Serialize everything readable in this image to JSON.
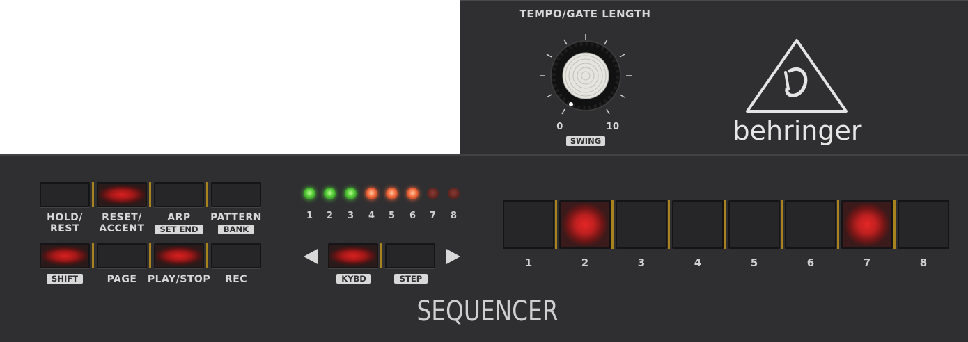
{
  "knob": {
    "title": "TEMPO/GATE LENGTH",
    "min_label": "0",
    "max_label": "10",
    "swing_tag": "SWING",
    "value_fraction": 0.08
  },
  "brand": {
    "name": "behringer",
    "logo_icon": "behringer-triangle-logo-icon"
  },
  "buttons": [
    {
      "line1": "HOLD/",
      "line2": "REST",
      "lit": false
    },
    {
      "line1": "RESET/",
      "line2": "ACCENT",
      "lit": true
    },
    {
      "line1": "ARP",
      "tag": "SET END",
      "lit": false
    },
    {
      "line1": "PATTERN",
      "tag": "BANK",
      "lit": false
    },
    {
      "tag": "SHIFT",
      "lit": true
    },
    {
      "label": "PAGE",
      "lit": false
    },
    {
      "label": "PLAY/STOP",
      "lit": true
    },
    {
      "label": "REC",
      "lit": false
    }
  ],
  "step_leds": {
    "labels": [
      "1",
      "2",
      "3",
      "4",
      "5",
      "6",
      "7",
      "8"
    ],
    "states": [
      "green",
      "green",
      "green",
      "orange",
      "orange",
      "orange",
      "dim",
      "dim"
    ]
  },
  "transport": {
    "left_arrow_icon": "triangle-left-icon",
    "right_arrow_icon": "triangle-right-icon",
    "kybd_tag": "KYBD",
    "step_tag": "STEP",
    "kybd_lit": true,
    "step_lit": false
  },
  "pads": {
    "labels": [
      "1",
      "2",
      "3",
      "4",
      "5",
      "6",
      "7",
      "8"
    ],
    "lit": [
      false,
      true,
      false,
      false,
      false,
      false,
      true,
      false
    ]
  },
  "section_title": "SEQUENCER"
}
